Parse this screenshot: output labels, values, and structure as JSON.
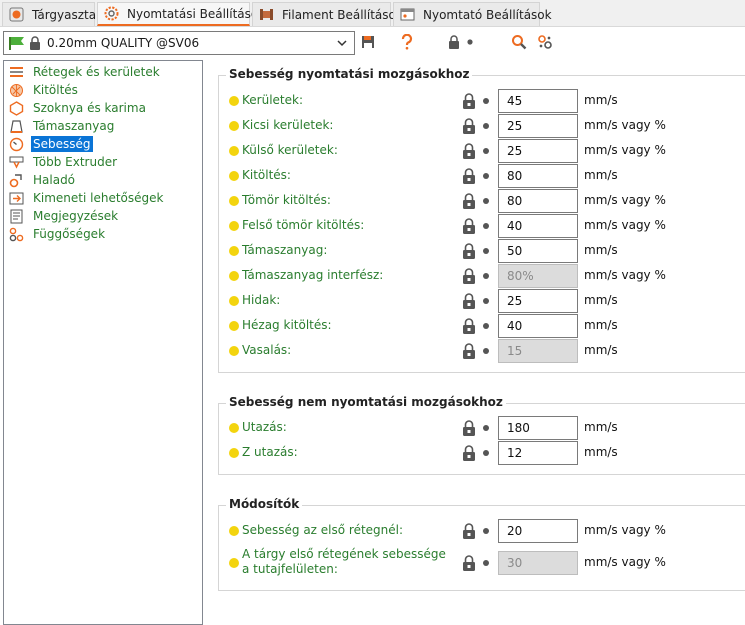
{
  "tabs": [
    {
      "label": "Tárgyasztal",
      "icon": "plater-icon"
    },
    {
      "label": "Nyomtatási Beállítások",
      "icon": "print-settings-gear-icon"
    },
    {
      "label": "Filament Beállítások",
      "icon": "filament-spool-icon"
    },
    {
      "label": "Nyomtató Beállítások",
      "icon": "printer-icon"
    }
  ],
  "preset": {
    "value": "0.20mm QUALITY @SV06"
  },
  "tree": [
    {
      "label": "Rétegek és kerületek",
      "icon": "layers-icon"
    },
    {
      "label": "Kitöltés",
      "icon": "infill-icon"
    },
    {
      "label": "Szoknya és karima",
      "icon": "skirt-brim-icon"
    },
    {
      "label": "Támaszanyag",
      "icon": "support-icon"
    },
    {
      "label": "Sebesség",
      "icon": "speed-icon",
      "selected": true
    },
    {
      "label": "Több Extruder",
      "icon": "multi-extruder-icon"
    },
    {
      "label": "Haladó",
      "icon": "advanced-icon"
    },
    {
      "label": "Kimeneti lehetőségek",
      "icon": "output-icon"
    },
    {
      "label": "Megjegyzések",
      "icon": "notes-icon"
    },
    {
      "label": "Függőségek",
      "icon": "dependencies-icon"
    }
  ],
  "groups": [
    {
      "title": "Sebesség nyomtatási mozgásokhoz",
      "rows": [
        {
          "label": "Kerületek:",
          "value": "45",
          "unit": "mm/s"
        },
        {
          "label": "Kicsi kerületek:",
          "value": "25",
          "unit": "mm/s vagy %"
        },
        {
          "label": "Külső kerületek:",
          "value": "25",
          "unit": "mm/s vagy %"
        },
        {
          "label": "Kitöltés:",
          "value": "80",
          "unit": "mm/s"
        },
        {
          "label": "Tömör kitöltés:",
          "value": "80",
          "unit": "mm/s vagy %"
        },
        {
          "label": "Felső tömör kitöltés:",
          "value": "40",
          "unit": "mm/s vagy %"
        },
        {
          "label": "Támaszanyag:",
          "value": "50",
          "unit": "mm/s"
        },
        {
          "label": "Támaszanyag interfész:",
          "value": "80%",
          "unit": "mm/s vagy %",
          "disabled": true
        },
        {
          "label": "Hidak:",
          "value": "25",
          "unit": "mm/s"
        },
        {
          "label": "Hézag kitöltés:",
          "value": "40",
          "unit": "mm/s"
        },
        {
          "label": "Vasalás:",
          "value": "15",
          "unit": "mm/s",
          "disabled": true
        }
      ]
    },
    {
      "title": "Sebesség nem nyomtatási mozgásokhoz",
      "rows": [
        {
          "label": "Utazás:",
          "value": "180",
          "unit": "mm/s"
        },
        {
          "label": "Z utazás:",
          "value": "12",
          "unit": "mm/s"
        }
      ]
    },
    {
      "title": "Módosítók",
      "rows": [
        {
          "label": "Sebesség az első rétegnél:",
          "value": "20",
          "unit": "mm/s vagy %"
        },
        {
          "label": "A tárgy első rétegének sebessége a tutajfelületen:",
          "value": "30",
          "unit": "mm/s vagy %",
          "disabled": true
        }
      ]
    }
  ],
  "colors": {
    "accent": "#ed6b21",
    "label_green": "#2a7d2e",
    "dot_yellow": "#f3d40e",
    "selection_blue": "#0a74d6"
  }
}
